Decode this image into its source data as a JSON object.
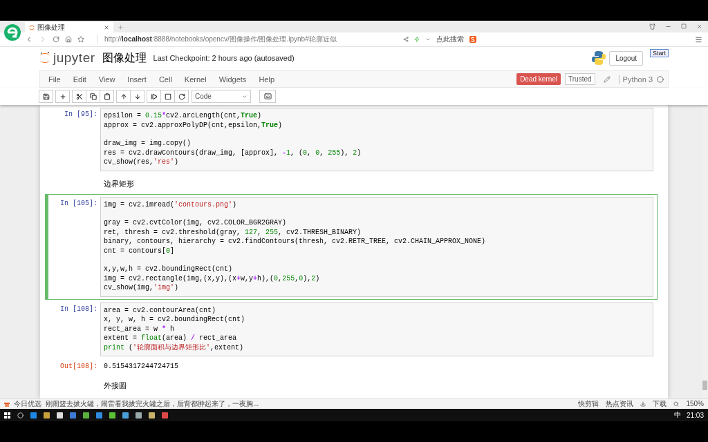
{
  "browser": {
    "tab_title": "图像处理",
    "url_prefix": "http://",
    "url_host": "localhost",
    "url_rest": ":8888/notebooks/opencv/图像操作/图像处理.ipynb#轮廓近似",
    "search_hint": "点此搜索"
  },
  "notebook": {
    "logo_text": "jupyter",
    "title": "图像处理",
    "checkpoint": "Last Checkpoint: 2 hours ago (autosaved)",
    "logout": "Logout",
    "start": "Start",
    "menus": [
      "File",
      "Edit",
      "View",
      "Insert",
      "Cell",
      "Kernel",
      "Widgets",
      "Help"
    ],
    "cell_type": "Code",
    "kernel_status": "Dead kernel",
    "trusted": "Trusted",
    "kernel_name": "Python 3"
  },
  "cells": [
    {
      "kind": "code",
      "prompt": "In [95]:",
      "selected": false,
      "blocks": [
        [
          [
            {
              "kind": "plain",
              "text": "epsilon = "
            },
            {
              "kind": "number",
              "text": "0.15"
            },
            {
              "kind": "operator",
              "text": "*"
            },
            {
              "kind": "plain",
              "text": "cv2.arcLength(cnt,"
            },
            {
              "kind": "keyword",
              "text": "True"
            },
            {
              "kind": "plain",
              "text": ")"
            }
          ],
          [
            {
              "kind": "plain",
              "text": "approx = cv2.approxPolyDP(cnt,epsilon,"
            },
            {
              "kind": "keyword",
              "text": "True"
            },
            {
              "kind": "plain",
              "text": ")"
            }
          ]
        ],
        [
          [
            {
              "kind": "plain",
              "text": "draw_img = img.copy()"
            }
          ],
          [
            {
              "kind": "plain",
              "text": "res = cv2.drawContours(draw_img, [approx], "
            },
            {
              "kind": "operator",
              "text": "-"
            },
            {
              "kind": "number",
              "text": "1"
            },
            {
              "kind": "plain",
              "text": ", ("
            },
            {
              "kind": "number",
              "text": "0"
            },
            {
              "kind": "plain",
              "text": ", "
            },
            {
              "kind": "number",
              "text": "0"
            },
            {
              "kind": "plain",
              "text": ", "
            },
            {
              "kind": "number",
              "text": "255"
            },
            {
              "kind": "plain",
              "text": "), "
            },
            {
              "kind": "number",
              "text": "2"
            },
            {
              "kind": "plain",
              "text": ")"
            }
          ],
          [
            {
              "kind": "plain",
              "text": "cv_show(res,"
            },
            {
              "kind": "string",
              "text": "'res'"
            },
            {
              "kind": "plain",
              "text": ")"
            }
          ]
        ]
      ]
    },
    {
      "kind": "markdown",
      "text": "边界矩形"
    },
    {
      "kind": "code",
      "prompt": "In [105]:",
      "selected": true,
      "blocks": [
        [
          [
            {
              "kind": "plain",
              "text": "img = cv2.imread("
            },
            {
              "kind": "string",
              "text": "'contours.png'"
            },
            {
              "kind": "plain",
              "text": ")"
            }
          ]
        ],
        [
          [
            {
              "kind": "plain",
              "text": "gray = cv2.cvtColor(img, cv2.COLOR_BGR2GRAY)"
            }
          ],
          [
            {
              "kind": "plain",
              "text": "ret, thresh = cv2.threshold(gray, "
            },
            {
              "kind": "number",
              "text": "127"
            },
            {
              "kind": "plain",
              "text": ", "
            },
            {
              "kind": "number",
              "text": "255"
            },
            {
              "kind": "plain",
              "text": ", cv2.THRESH_BINARY)"
            }
          ],
          [
            {
              "kind": "plain",
              "text": "binary, contours, hierarchy = cv2.findContours(thresh, cv2.RETR_TREE, cv2.CHAIN_APPROX_NONE)"
            }
          ],
          [
            {
              "kind": "plain",
              "text": "cnt = contours["
            },
            {
              "kind": "number",
              "text": "0"
            },
            {
              "kind": "plain",
              "text": "]"
            }
          ]
        ],
        [
          [
            {
              "kind": "plain",
              "text": "x,y,w,h = cv2.boundingRect(cnt)"
            }
          ],
          [
            {
              "kind": "plain",
              "text": "img = cv2.rectangle(img,(x,y),(x"
            },
            {
              "kind": "operator",
              "text": "+"
            },
            {
              "kind": "plain",
              "text": "w,y"
            },
            {
              "kind": "operator",
              "text": "+"
            },
            {
              "kind": "plain",
              "text": "h),("
            },
            {
              "kind": "number",
              "text": "0"
            },
            {
              "kind": "plain",
              "text": ","
            },
            {
              "kind": "number",
              "text": "255"
            },
            {
              "kind": "plain",
              "text": ","
            },
            {
              "kind": "number",
              "text": "0"
            },
            {
              "kind": "plain",
              "text": "),"
            },
            {
              "kind": "number",
              "text": "2"
            },
            {
              "kind": "plain",
              "text": ")"
            }
          ],
          [
            {
              "kind": "plain",
              "text": "cv_show(img,"
            },
            {
              "kind": "string",
              "text": "'img'"
            },
            {
              "kind": "plain",
              "text": ")"
            }
          ]
        ]
      ]
    },
    {
      "kind": "code",
      "prompt": "In [108]:",
      "selected": false,
      "blocks": [
        [
          [
            {
              "kind": "plain",
              "text": "area = cv2.contourArea(cnt)"
            }
          ],
          [
            {
              "kind": "plain",
              "text": "x, y, w, h = cv2.boundingRect(cnt)"
            }
          ],
          [
            {
              "kind": "plain",
              "text": "rect_area = w "
            },
            {
              "kind": "operator",
              "text": "*"
            },
            {
              "kind": "plain",
              "text": " h"
            }
          ],
          [
            {
              "kind": "plain",
              "text": "extent = "
            },
            {
              "kind": "builtin",
              "text": "float"
            },
            {
              "kind": "plain",
              "text": "(area) "
            },
            {
              "kind": "operator",
              "text": "/"
            },
            {
              "kind": "plain",
              "text": " rect_area"
            }
          ],
          [
            {
              "kind": "builtin",
              "text": "print"
            },
            {
              "kind": "plain",
              "text": " ("
            },
            {
              "kind": "string",
              "text": "'轮廓面积与边界矩形比'"
            },
            {
              "kind": "plain",
              "text": ",extent)"
            }
          ]
        ]
      ]
    },
    {
      "kind": "output",
      "prompt": "Out[108]:",
      "text": "0.5154317244724715"
    },
    {
      "kind": "markdown",
      "text": "外接圆"
    }
  ],
  "status_bar": {
    "left_label": "今日优选",
    "news": "刚闹篮去拔火罐，闹雷看我拔完火罐之后，后背都肿起来了，一夜胸...",
    "right": [
      "快剪辑",
      "热点资讯"
    ],
    "download": "下载",
    "zoom": "150%"
  },
  "taskbar": {
    "ime": "中",
    "time": "21:03"
  }
}
